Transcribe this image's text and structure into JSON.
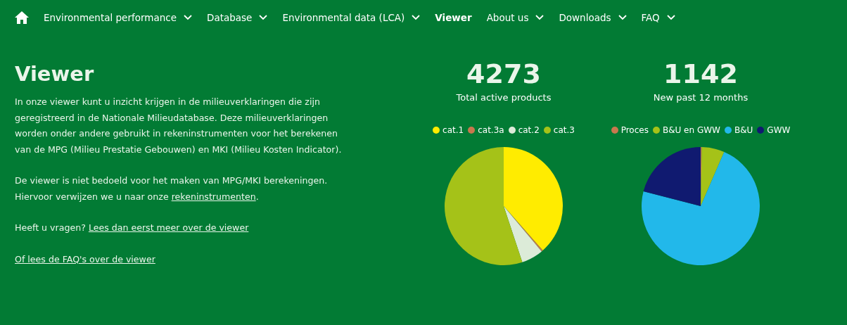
{
  "nav": {
    "items": [
      {
        "label": "Environmental performance",
        "selected": false,
        "dropdown": true
      },
      {
        "label": "Database",
        "selected": false,
        "dropdown": true
      },
      {
        "label": "Environmental data (LCA)",
        "selected": false,
        "dropdown": true
      },
      {
        "label": "Viewer",
        "selected": true,
        "dropdown": false
      },
      {
        "label": "About us",
        "selected": false,
        "dropdown": true
      },
      {
        "label": "Downloads",
        "selected": false,
        "dropdown": true
      },
      {
        "label": "FAQ",
        "selected": false,
        "dropdown": true
      }
    ]
  },
  "title": "Viewer",
  "paragraphs": [
    [
      {
        "kind": "text",
        "text": "In onze viewer kunt u inzicht krijgen in de milieuverklaringen die zijn geregistreerd in de Nationale Milieudatabase. Deze milieuverklaringen worden onder andere gebruikt in rekeninstrumenten voor het berekenen van de MPG (Milieu Prestatie Gebouwen) en MKI (Milieu Kosten Indicator)."
      }
    ],
    [
      {
        "kind": "text",
        "text": "De viewer is niet bedoeld voor het maken van MPG/MKI berekeningen. Hiervoor verwijzen we u naar onze "
      },
      {
        "kind": "link",
        "text": "rekeninstrumenten"
      },
      {
        "kind": "text",
        "text": "."
      }
    ],
    [
      {
        "kind": "text",
        "text": "Heeft u vragen? "
      },
      {
        "kind": "link",
        "text": "Lees dan eerst meer over de viewer"
      }
    ],
    [
      {
        "kind": "link",
        "text": "Of lees de FAQ's over de viewer"
      }
    ]
  ],
  "stats": [
    {
      "value": "4273",
      "label": "Total active products",
      "legend": [
        {
          "label": "cat.1",
          "color": "#ffec00"
        },
        {
          "label": "cat.3a",
          "color": "#c8784e"
        },
        {
          "label": "cat.2",
          "color": "#dcebd8"
        },
        {
          "label": "cat.3",
          "color": "#a5c218"
        }
      ]
    },
    {
      "value": "1142",
      "label": "New past 12 months",
      "legend": [
        {
          "label": "Proces",
          "color": "#c8784e"
        },
        {
          "label": "B&U en GWW",
          "color": "#a5c218"
        },
        {
          "label": "B&U",
          "color": "#22b8ea"
        },
        {
          "label": "GWW",
          "color": "#101a70"
        }
      ]
    }
  ]
}
